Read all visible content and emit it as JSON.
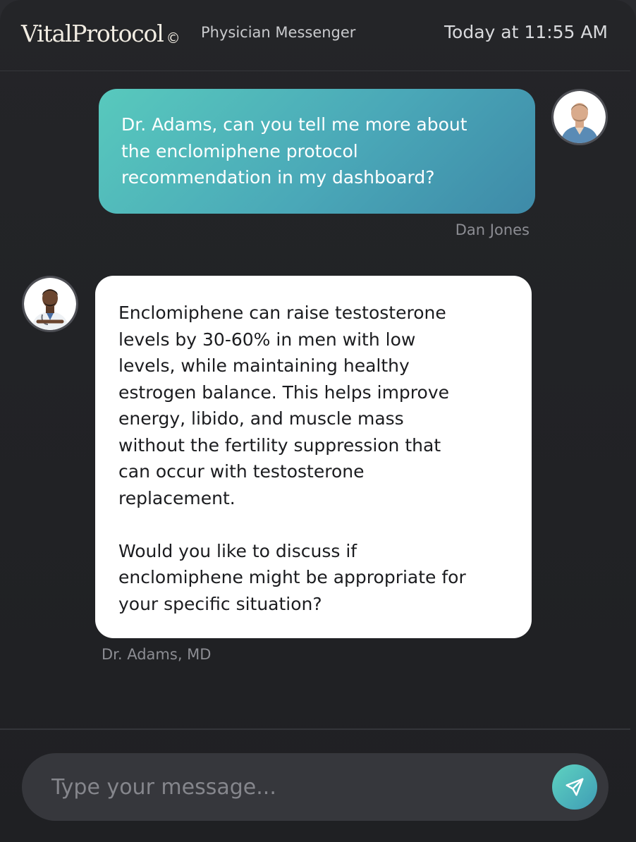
{
  "header": {
    "brand_name": "VitalProtocol",
    "brand_mark": "©",
    "app_name": "Physician Messenger",
    "timestamp": "Today at 11:55 AM"
  },
  "messages": [
    {
      "sender": "Dan Jones",
      "role": "patient",
      "text": "Dr. Adams, can you tell me more about\nthe enclomiphene protocol\nrecommendation in my dashboard?"
    },
    {
      "sender": "Dr. Adams, MD",
      "role": "physician",
      "text": "Enclomiphene can raise testosterone\nlevels by 30-60% in men with low\nlevels, while maintaining healthy\nestrogen balance. This helps improve\nenergy, libido, and muscle mass\nwithout the fertility suppression that\ncan occur with testosterone\nreplacement.\n\nWould you like to discuss if\nenclomiphene might be appropriate for\nyour specific situation?"
    }
  ],
  "composer": {
    "placeholder": "Type your message...",
    "send_icon": "send-icon"
  },
  "colors": {
    "background": "#1f2023",
    "user_bubble_start": "#58c9bd",
    "user_bubble_end": "#3e8aa8",
    "physician_bubble": "#ffffff",
    "send_button_start": "#5ed2c0",
    "send_button_end": "#3f9db6"
  }
}
